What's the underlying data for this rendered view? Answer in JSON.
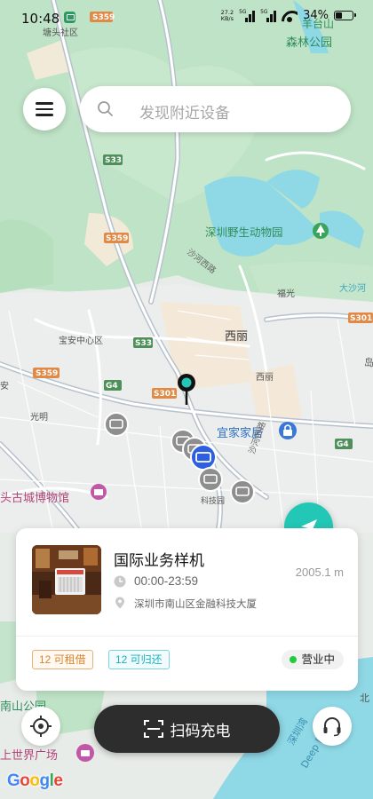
{
  "status_bar": {
    "time": "10:48",
    "net_speed_value": "27.2",
    "net_speed_unit": "KB/s",
    "sim1_label": "5G",
    "sim2_label": "5G",
    "battery": "34%"
  },
  "search": {
    "placeholder": "发现附近设备"
  },
  "map": {
    "labels": {
      "l1": "塘头社区",
      "l2": "S359",
      "l3": "羊台山",
      "l4": "森林公园",
      "l5": "S33",
      "l6": "S359",
      "l7": "深圳野生动物园",
      "l8": "沙河西路",
      "l9": "福光",
      "l10": "大沙河",
      "l11": "S301",
      "l12": "西丽",
      "l13": "宝安中心区",
      "l14": "S33",
      "l15": "S359",
      "l16": "G4",
      "l17": "S301",
      "l18": "西丽",
      "l19": "安",
      "l20": "光明",
      "l21": "宜家家居",
      "l22": "沙河西路",
      "l23": "G4",
      "l24": "科技园",
      "l25": "头古城博物馆",
      "l26": "南山公园",
      "l27": "上世界广场",
      "l28": "深圳湾",
      "l29": "Deep Bay",
      "l30": "岛",
      "l31": "北"
    },
    "colors": {
      "land": "#e6ebe6",
      "forest": "#bfe3c6",
      "water": "#8fd8e6",
      "road": "#ffffff",
      "highway": "#b7c2cc"
    }
  },
  "store_card": {
    "name": "国际业务样机",
    "distance": "2005.1 m",
    "hours": "00:00-23:59",
    "address": "深圳市南山区金融科技大厦",
    "rent_badge": "12 可租借",
    "return_badge": "12 可归还",
    "status": "营业中"
  },
  "bottom": {
    "scan_label": "扫码充电"
  },
  "google": {
    "text": "Google",
    "colors": [
      "#4285f4",
      "#ea4335",
      "#fbbc05",
      "#4285f4",
      "#34a853",
      "#ea4335"
    ]
  },
  "theme": {
    "accent": "#22c7b6",
    "status_green": "#1fcc3b",
    "rent_orange": "#d8842c",
    "return_teal": "#18b1bd"
  }
}
